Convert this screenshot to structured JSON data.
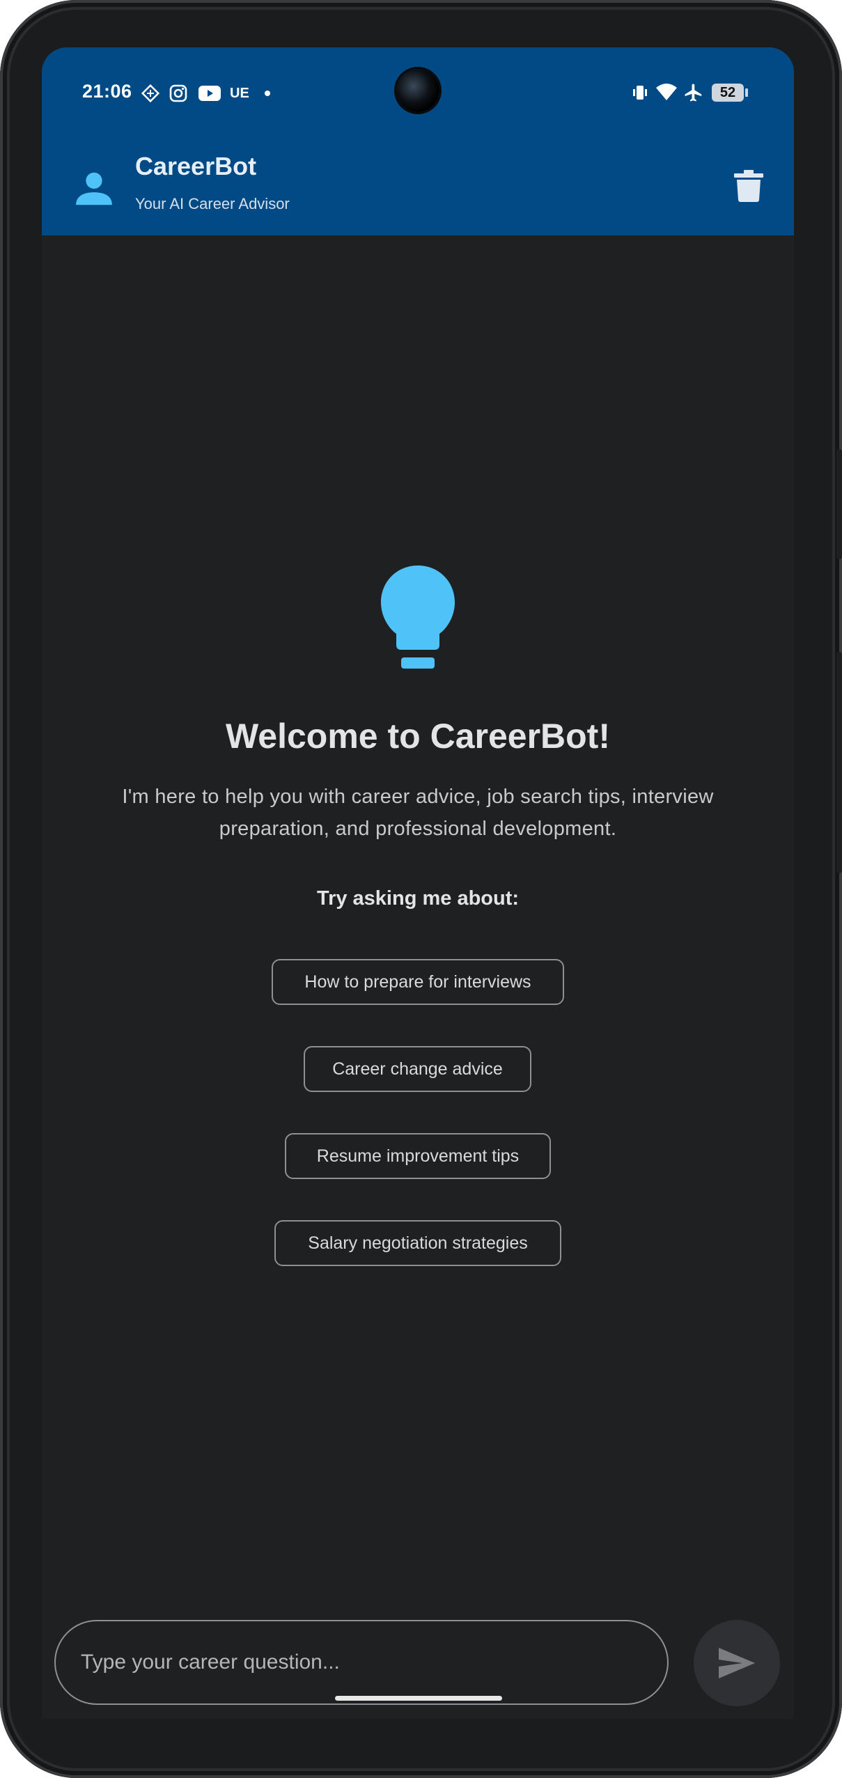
{
  "status_bar": {
    "time": "21:06",
    "carrier_label": "UE",
    "battery": "52",
    "icons": [
      "diamond-app-icon",
      "instagram-icon",
      "youtube-icon",
      "notification-dot-icon",
      "vibrate-icon",
      "wifi-icon",
      "airplane-icon",
      "battery-icon"
    ]
  },
  "header": {
    "title": "CareerBot",
    "subtitle": "Your AI Career Advisor",
    "avatar_icon": "person-icon",
    "action_icon": "trash-icon"
  },
  "welcome": {
    "icon": "lightbulb-icon",
    "title": "Welcome to CareerBot!",
    "text": "I'm here to help you with career advice, job search tips, interview preparation, and professional development.",
    "try_label": "Try asking me about:"
  },
  "suggestions": [
    {
      "label": "How to prepare for interviews"
    },
    {
      "label": "Career change advice"
    },
    {
      "label": "Resume improvement tips"
    },
    {
      "label": "Salary negotiation strategies"
    }
  ],
  "composer": {
    "placeholder": "Type your career question...",
    "send_icon": "send-icon"
  },
  "colors": {
    "app_bar": "#014a85",
    "accent": "#4fc3f7",
    "background": "#1f2022"
  }
}
